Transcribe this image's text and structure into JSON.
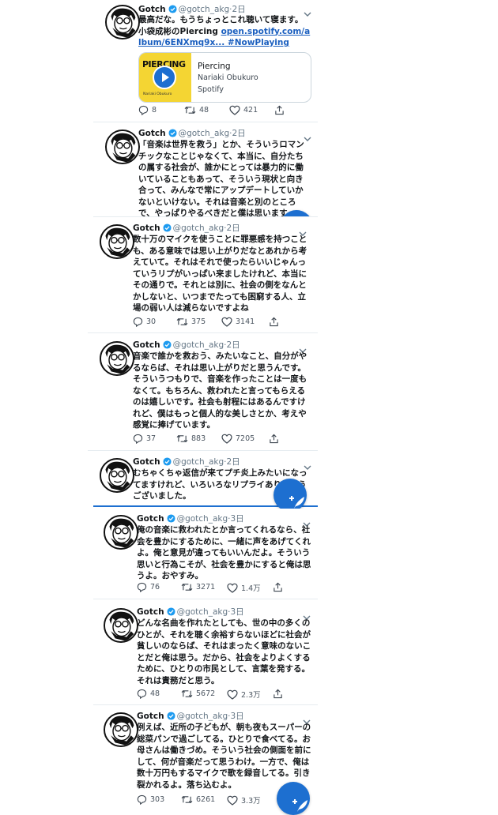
{
  "colors": {
    "accent": "#1d6fd0",
    "link": "#1b5fbf",
    "text": "#14171a",
    "muted": "#657786",
    "album_yellow": "#f4d533"
  },
  "tweets": [
    {
      "name": "Gotch",
      "handle": "@gotch_akg",
      "sep": "·",
      "time": "2日",
      "text": "最高だな。もうちょっとこれ聴いて寝ます。 小袋成彬のPiercing ",
      "link": "open.spotify.com/album/6ENXmq9x...",
      "hashtag": " #NowPlaying",
      "card": {
        "title": "Piercing",
        "artist": "Nariaki Obukuro",
        "source": "Spotify",
        "cover_text": "PIERCING",
        "cover_sub": "Nariaki Obukuro"
      },
      "replies": "8",
      "retweets": "48",
      "likes": "421"
    },
    {
      "name": "Gotch",
      "handle": "@gotch_akg",
      "sep": "·",
      "time": "2日",
      "text": "「音楽は世界を救う」とか、そういうロマンチックなことじゃなくて、本当に、自分たちの属する社会が、誰かにとっては暴力的に働いていることもあって、そういう現状と向き合って、みんなで常にアップデートしていかないといけない。それは音楽と別のところで、やっぱりやるべきだと僕は思います。"
    },
    {
      "name": "Gotch",
      "handle": "@gotch_akg",
      "sep": "·",
      "time": "2日",
      "text": "数十万のマイクを使うことに罪悪感を持つことも、ある意味では思い上がりだなとあれから考えていて。それはそれで使ったらいいじゃんっていうリプがいっぱい来ましたけれど、本当にその通りで。それとは別に、社会の側をなんとかしないと、いつまでたっても困窮する人、立場の弱い人は減らないですよね",
      "replies": "30",
      "retweets": "375",
      "likes": "3141"
    },
    {
      "name": "Gotch",
      "handle": "@gotch_akg",
      "sep": "·",
      "time": "2日",
      "text": "音楽で誰かを救おう、みたいなこと、自分がやるならば、それは思い上がりだと思うんです。そういうつもりで、音楽を作ったことは一度もなくて。もちろん、救われたと言ってもらえるのは嬉しいです。社会も射程にはあるんですけれど、僕はもっと個人的な美しさとか、考えや感覚に捧げています。",
      "replies": "37",
      "retweets": "883",
      "likes": "7205"
    },
    {
      "name": "Gotch",
      "handle": "@gotch_akg",
      "sep": "·",
      "time": "2日",
      "text": "むちゃくちゃ返信が来てプチ炎上みたいになってますけれど、いろいろなリプライありがとうございました。"
    },
    {
      "name": "Gotch",
      "handle": "@gotch_akg",
      "sep": "·",
      "time": "3日",
      "text": "俺の音楽に救われたとか言ってくれるなら、社会を豊かにするために、一緒に声をあげてくれよ。俺と意見が違ってもいいんだよ。そういう思いと行為こそが、社会を豊かにすると俺は思うよ。おやすみ。",
      "replies": "76",
      "retweets": "3271",
      "likes": "1.4万"
    },
    {
      "name": "Gotch",
      "handle": "@gotch_akg",
      "sep": "·",
      "time": "3日",
      "text": "どんな名曲を作れたとしても、世の中の多くのひとが、それを聴く余裕すらないほどに社会が貧しいのならば、それはまったく意味のないことだと俺は思う。だから、社会をよりよくするために、ひとりの市民として、言葉を発する。それは責務だと思う。",
      "replies": "48",
      "retweets": "5672",
      "likes": "2.3万"
    },
    {
      "name": "Gotch",
      "handle": "@gotch_akg",
      "sep": "·",
      "time": "3日",
      "text": "例えば、近所の子どもが、朝も夜もスーパーの総菜パンで過ごしてる。ひとりで食べてる。お母さんは働きづめ。そういう社会の側面を前にして、何が音楽だって思うわけ。一方で、俺は数十万円もするマイクで歌を録音してる。引き裂かれるよ。落ち込むよ。",
      "replies": "303",
      "retweets": "6261",
      "likes": "3.3万"
    }
  ]
}
